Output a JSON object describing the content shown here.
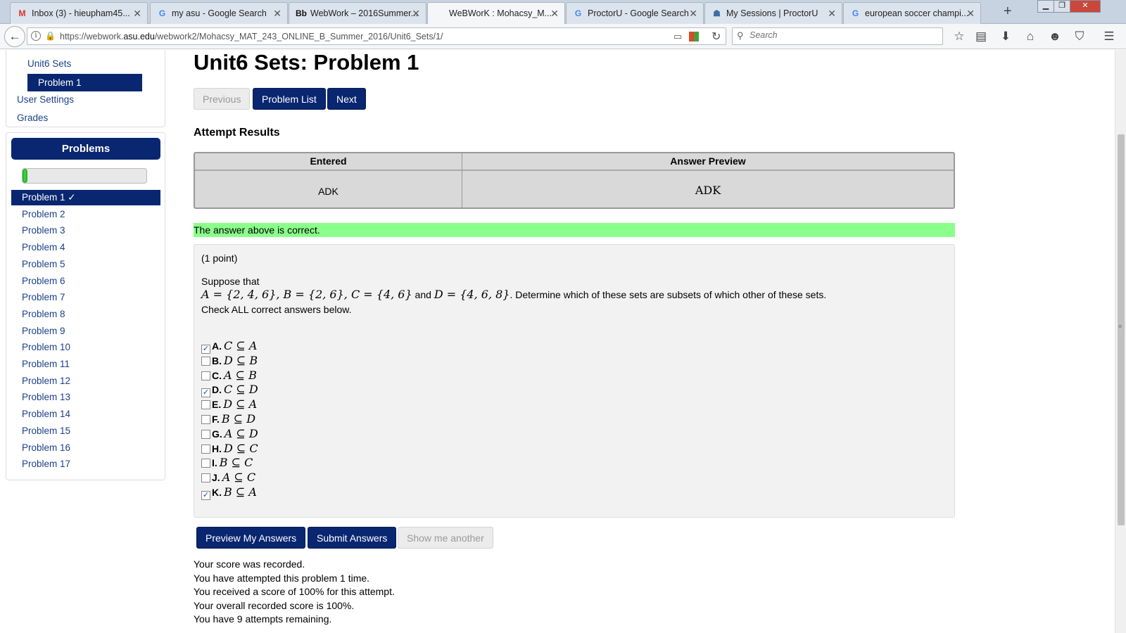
{
  "browser": {
    "tabs": [
      {
        "icon": "gmail-icon",
        "glyph": "M",
        "color": "#d93025",
        "title": "Inbox (3) - hieupham45...",
        "active": false
      },
      {
        "icon": "google-icon",
        "glyph": "G",
        "color": "#4285f4",
        "title": "my asu - Google Search",
        "active": false
      },
      {
        "icon": "blackboard-icon",
        "glyph": "Bb",
        "color": "#111111",
        "title": "WebWork – 2016Summer...",
        "active": false
      },
      {
        "icon": "webwork-icon",
        "glyph": "",
        "color": "#092670",
        "title": "WeBWorK : Mohacsy_M...",
        "active": true
      },
      {
        "icon": "google-icon",
        "glyph": "G",
        "color": "#4285f4",
        "title": "ProctorU - Google Search",
        "active": false
      },
      {
        "icon": "proctoru-icon",
        "glyph": "☗",
        "color": "#3a6ea5",
        "title": "My Sessions | ProctorU",
        "active": false
      },
      {
        "icon": "google-icon",
        "glyph": "G",
        "color": "#4285f4",
        "title": "european soccer champi...",
        "active": false
      }
    ],
    "url_prefix": "https://webwork.",
    "url_domain": "asu.edu",
    "url_path": "/webwork2/Mohacsy_MAT_243_ONLINE_B_Summer_2016/Unit6_Sets/1/",
    "search_placeholder": "Search"
  },
  "sidebar": {
    "breadcrumb_set": "Unit6 Sets",
    "breadcrumb_problem": "Problem 1",
    "user_settings": "User Settings",
    "grades": "Grades",
    "problems_heading": "Problems",
    "progress_fraction": 0.04,
    "problems": [
      {
        "label": "Problem 1 ✓",
        "active": true
      },
      {
        "label": "Problem 2",
        "active": false
      },
      {
        "label": "Problem 3",
        "active": false
      },
      {
        "label": "Problem 4",
        "active": false
      },
      {
        "label": "Problem 5",
        "active": false
      },
      {
        "label": "Problem 6",
        "active": false
      },
      {
        "label": "Problem 7",
        "active": false
      },
      {
        "label": "Problem 8",
        "active": false
      },
      {
        "label": "Problem 9",
        "active": false
      },
      {
        "label": "Problem 10",
        "active": false
      },
      {
        "label": "Problem 11",
        "active": false
      },
      {
        "label": "Problem 12",
        "active": false
      },
      {
        "label": "Problem 13",
        "active": false
      },
      {
        "label": "Problem 14",
        "active": false
      },
      {
        "label": "Problem 15",
        "active": false
      },
      {
        "label": "Problem 16",
        "active": false
      },
      {
        "label": "Problem 17",
        "active": false
      }
    ]
  },
  "main": {
    "title": "Unit6 Sets: Problem 1",
    "nav": {
      "previous": "Previous",
      "problem_list": "Problem List",
      "next": "Next"
    },
    "attempt_results_title": "Attempt Results",
    "results": {
      "col_entered": "Entered",
      "col_preview": "Answer Preview",
      "entered": "ADK",
      "preview": "ADK"
    },
    "correct_message": "The answer above is correct.",
    "problem": {
      "points": "(1 point)",
      "intro": "Suppose that",
      "set_a": "A = {2, 4, 6}, ",
      "set_b": "B = {2, 6}, ",
      "set_c": "C = {4, 6}",
      "and": " and ",
      "set_d": "D = {4, 6, 8}",
      "question": ". Determine which of these sets are subsets of which other of these sets.",
      "instruction": "Check ALL correct answers below.",
      "choices": [
        {
          "letter": "A.",
          "expr": "C ⊆ A",
          "checked": true
        },
        {
          "letter": "B.",
          "expr": "D ⊆ B",
          "checked": false
        },
        {
          "letter": "C.",
          "expr": "A ⊆ B",
          "checked": false
        },
        {
          "letter": "D.",
          "expr": "C ⊆ D",
          "checked": true
        },
        {
          "letter": "E.",
          "expr": "D ⊆ A",
          "checked": false
        },
        {
          "letter": "F.",
          "expr": "B ⊆ D",
          "checked": false
        },
        {
          "letter": "G.",
          "expr": "A ⊆ D",
          "checked": false
        },
        {
          "letter": "H.",
          "expr": "D ⊆ C",
          "checked": false
        },
        {
          "letter": "I.",
          "expr": "B ⊆ C",
          "checked": false
        },
        {
          "letter": "J.",
          "expr": "A ⊆ C",
          "checked": false
        },
        {
          "letter": "K.",
          "expr": "B ⊆ A",
          "checked": true
        }
      ]
    },
    "buttons": {
      "preview": "Preview My Answers",
      "submit": "Submit Answers",
      "show_another": "Show me another"
    },
    "status": [
      "Your score was recorded.",
      "You have attempted this problem 1 time.",
      "You received a score of 100% for this attempt.",
      "Your overall recorded score is 100%.",
      "You have 9 attempts remaining."
    ]
  }
}
